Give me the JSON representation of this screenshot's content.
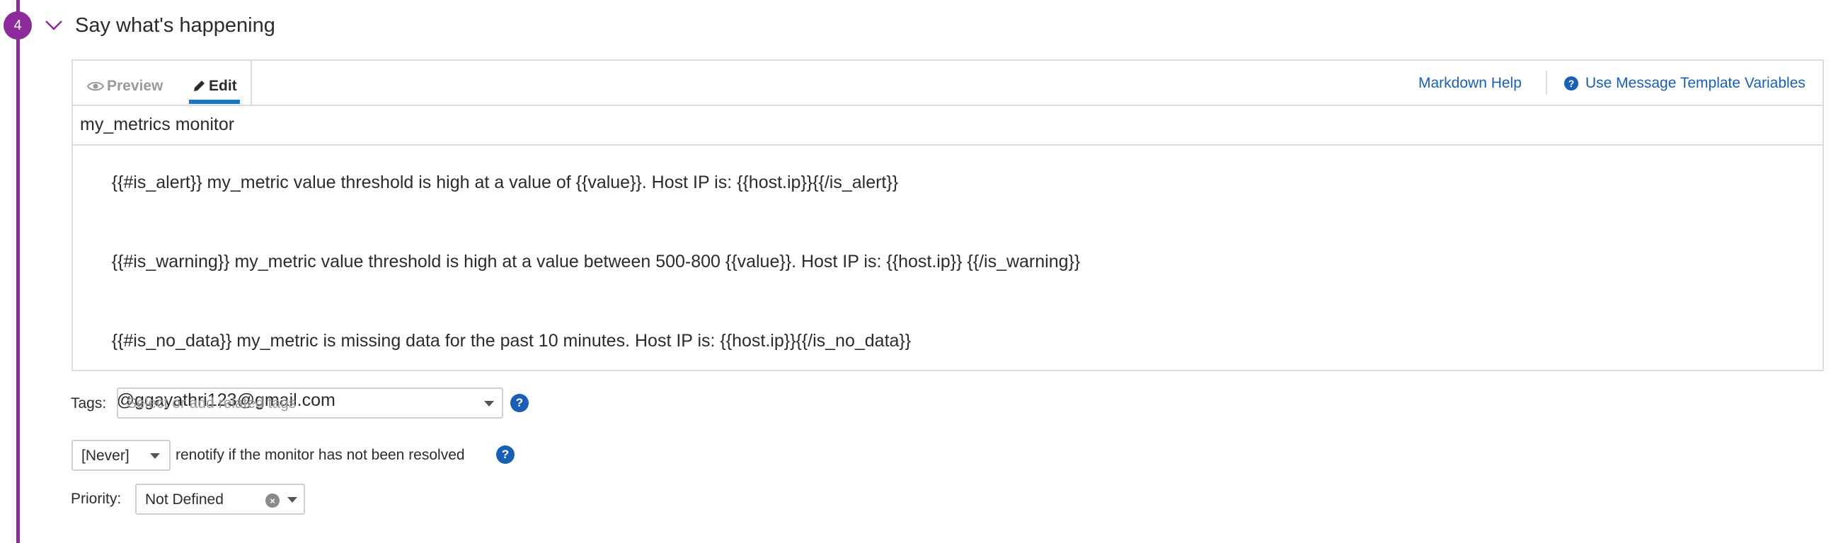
{
  "step": {
    "number": "4",
    "title": "Say what's happening"
  },
  "editor": {
    "tabs": {
      "preview": "Preview",
      "edit": "Edit"
    },
    "links": {
      "markdown_help": "Markdown Help",
      "template_variables": "Use Message Template Variables"
    },
    "title_value": "my_metrics monitor",
    "body_lines": [
      "{{#is_alert}} my_metric value threshold is high at a value of {{value}}. Host IP is: {{host.ip}}{{/is_alert}}",
      "{{#is_warning}} my_metric value threshold is high at a value between 500-800 {{value}}. Host IP is: {{host.ip}} {{/is_warning}}",
      "{{#is_no_data}} my_metric is missing data for the past 10 minutes. Host IP is: {{host.ip}}{{/is_no_data}}",
      " @ggayathri123@gmail.com"
    ]
  },
  "tags": {
    "label": "Tags:",
    "placeholder": "Select or add related tags"
  },
  "renotify": {
    "selected": "[Never]",
    "text": "renotify if the monitor has not been resolved"
  },
  "priority": {
    "label": "Priority:",
    "selected": "Not Defined"
  },
  "colors": {
    "accent_purple": "#8d2a9c",
    "link_blue": "#1a5fb4",
    "active_tab_underline": "#1a73c9"
  }
}
